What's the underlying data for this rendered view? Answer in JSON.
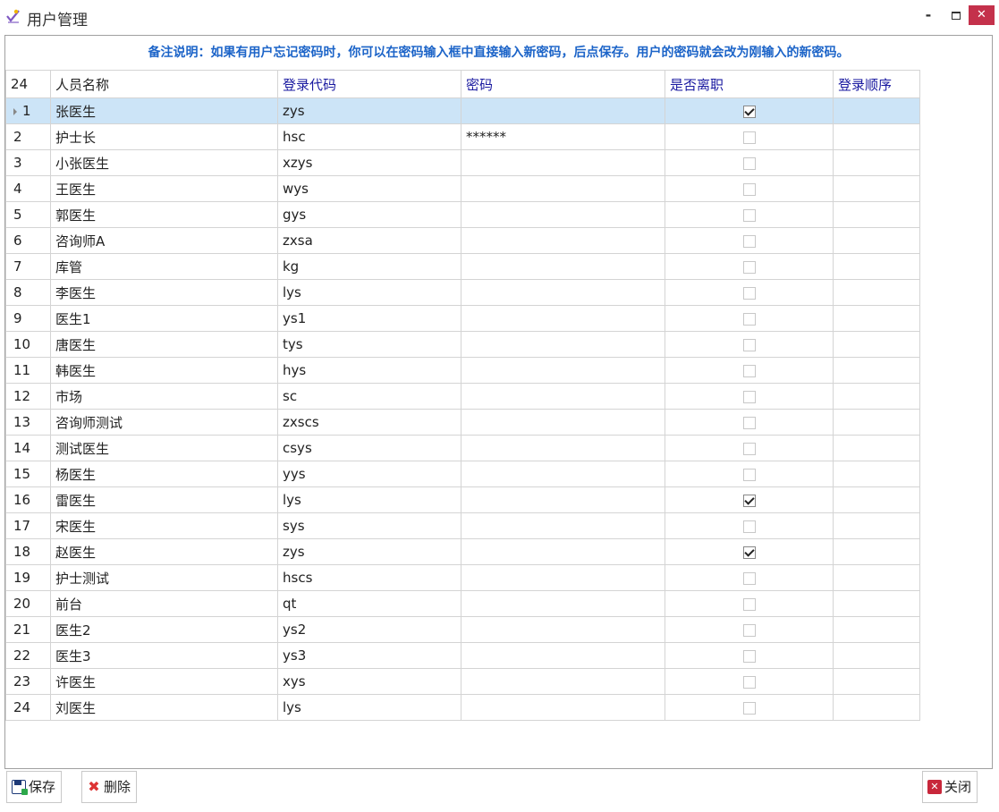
{
  "window": {
    "title": "用户管理",
    "minimize_glyph": "-",
    "close_glyph": "✕"
  },
  "note": "备注说明：如果有用户忘记密码时，你可以在密码输入框中直接输入新密码，后点保存。用户的密码就会改为刚输入的新密码。",
  "table": {
    "headers": {
      "count": "24",
      "name": "人员名称",
      "code": "登录代码",
      "password": "密码",
      "resigned": "是否离职",
      "order": "登录顺序"
    },
    "rows": [
      {
        "no": "1",
        "name": "张医生",
        "code": "zys",
        "password": "",
        "resigned": true
      },
      {
        "no": "2",
        "name": "护士长",
        "code": "hsc",
        "password": "******",
        "resigned": false
      },
      {
        "no": "3",
        "name": "小张医生",
        "code": "xzys",
        "password": "",
        "resigned": false
      },
      {
        "no": "4",
        "name": "王医生",
        "code": "wys",
        "password": "",
        "resigned": false
      },
      {
        "no": "5",
        "name": "郭医生",
        "code": "gys",
        "password": "",
        "resigned": false
      },
      {
        "no": "6",
        "name": "咨询师A",
        "code": "zxsa",
        "password": "",
        "resigned": false
      },
      {
        "no": "7",
        "name": "库管",
        "code": "kg",
        "password": "",
        "resigned": false
      },
      {
        "no": "8",
        "name": "李医生",
        "code": "lys",
        "password": "",
        "resigned": false
      },
      {
        "no": "9",
        "name": "医生1",
        "code": "ys1",
        "password": "",
        "resigned": false
      },
      {
        "no": "10",
        "name": "唐医生",
        "code": "tys",
        "password": "",
        "resigned": false
      },
      {
        "no": "11",
        "name": "韩医生",
        "code": "hys",
        "password": "",
        "resigned": false
      },
      {
        "no": "12",
        "name": "市场",
        "code": "sc",
        "password": "",
        "resigned": false
      },
      {
        "no": "13",
        "name": "咨询师测试",
        "code": "zxscs",
        "password": "",
        "resigned": false
      },
      {
        "no": "14",
        "name": "测试医生",
        "code": "csys",
        "password": "",
        "resigned": false
      },
      {
        "no": "15",
        "name": "杨医生",
        "code": "yys",
        "password": "",
        "resigned": false
      },
      {
        "no": "16",
        "name": "雷医生",
        "code": "lys",
        "password": "",
        "resigned": true
      },
      {
        "no": "17",
        "name": "宋医生",
        "code": "sys",
        "password": "",
        "resigned": false
      },
      {
        "no": "18",
        "name": "赵医生",
        "code": "zys",
        "password": "",
        "resigned": true
      },
      {
        "no": "19",
        "name": "护士测试",
        "code": "hscs",
        "password": "",
        "resigned": false
      },
      {
        "no": "20",
        "name": "前台",
        "code": "qt",
        "password": "",
        "resigned": false
      },
      {
        "no": "21",
        "name": "医生2",
        "code": "ys2",
        "password": "",
        "resigned": false
      },
      {
        "no": "22",
        "name": "医生3",
        "code": "ys3",
        "password": "",
        "resigned": false
      },
      {
        "no": "23",
        "name": "许医生",
        "code": "xys",
        "password": "",
        "resigned": false
      },
      {
        "no": "24",
        "name": "刘医生",
        "code": "lys",
        "password": "",
        "resigned": false
      }
    ]
  },
  "toolbar": {
    "save_label": "保存",
    "delete_label": "删除",
    "close_label": "关闭"
  },
  "colors": {
    "note_text": "#1c64c8",
    "header_text": "#1a1aa0",
    "selected_row": "#cce4f7",
    "close_button": "#c4314b"
  }
}
